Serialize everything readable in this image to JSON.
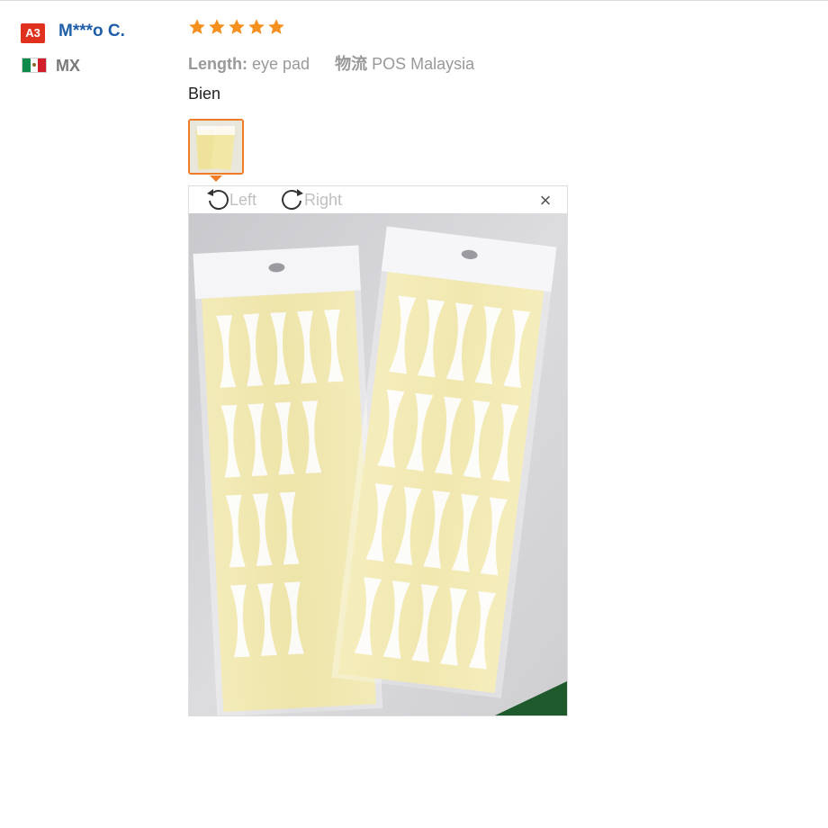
{
  "reviewer": {
    "badge": "A3",
    "name": "M***o C.",
    "country": "MX",
    "flag_colors": [
      "#0e8a4a",
      "#ffffff",
      "#d11e2a"
    ]
  },
  "rating": {
    "stars": 5,
    "max": 5,
    "color": "#f5901f"
  },
  "attributes": {
    "length_label": "Length:",
    "length_value": "eye pad",
    "shipping_label": "物流",
    "shipping_value": "POS Malaysia"
  },
  "review_text": "Bien",
  "viewer": {
    "rotate_left_label": "Left",
    "rotate_right_label": "Right",
    "close_icon": "close-icon"
  },
  "colors": {
    "accent": "#f07c28",
    "username": "#1f5ea8",
    "badge": "#e0301e"
  }
}
